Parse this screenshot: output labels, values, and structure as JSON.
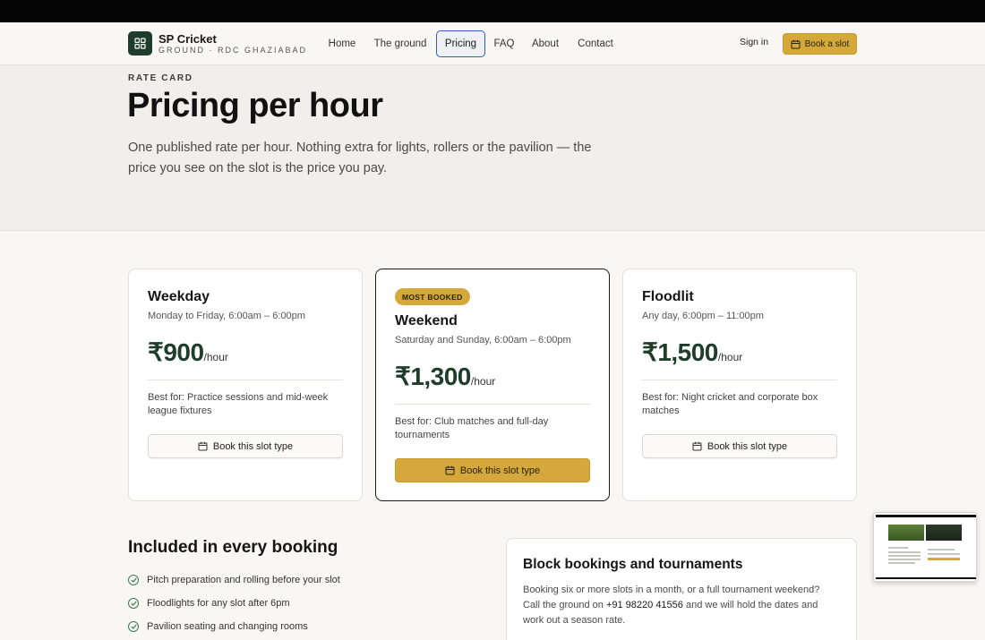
{
  "brand": {
    "name": "SP Cricket",
    "subtitle": "GROUND · RDC GHAZIABAD"
  },
  "nav": {
    "home": "Home",
    "ground": "The ground",
    "pricing": "Pricing",
    "faq": "FAQ",
    "about": "About",
    "contact": "Contact",
    "active": "Pricing"
  },
  "header": {
    "signin": "Sign in",
    "book": "Book a slot"
  },
  "hero": {
    "eyebrow": "RATE CARD",
    "title": "Pricing per hour",
    "lede": "One published rate per hour. Nothing extra for lights, rollers or the pavilion — the price you see on the slot is the price you pay."
  },
  "plans": [
    {
      "name": "Weekday",
      "hours": "Monday to Friday, 6:00am – 6:00pm",
      "price": "₹900",
      "unit": "/hour",
      "best": "Best for: Practice sessions and mid-week league fixtures",
      "cta": "Book this slot type"
    },
    {
      "badge": "MOST BOOKED",
      "name": "Weekend",
      "hours": "Saturday and Sunday, 6:00am – 6:00pm",
      "price": "₹1,300",
      "unit": "/hour",
      "best": "Best for: Club matches and full-day tournaments",
      "cta": "Book this slot type"
    },
    {
      "name": "Floodlit",
      "hours": "Any day, 6:00pm – 11:00pm",
      "price": "₹1,500",
      "unit": "/hour",
      "best": "Best for: Night cricket and corporate box matches",
      "cta": "Book this slot type"
    }
  ],
  "included": {
    "title": "Included in every booking",
    "items": [
      "Pitch preparation and rolling before your slot",
      "Floodlights for any slot after 6pm",
      "Pavilion seating and changing rooms"
    ]
  },
  "block": {
    "title": "Block bookings and tournaments",
    "body_pre": "Booking six or more slots in a month, or a full tournament weekend? Call the ground on ",
    "phone": "+91 98220 41556",
    "body_post": " and we will hold the dates and work out a season rate."
  },
  "colors": {
    "accent": "#d4a83a",
    "brand_green": "#1f3d2b",
    "active_nav_border": "#2d5ec6"
  }
}
